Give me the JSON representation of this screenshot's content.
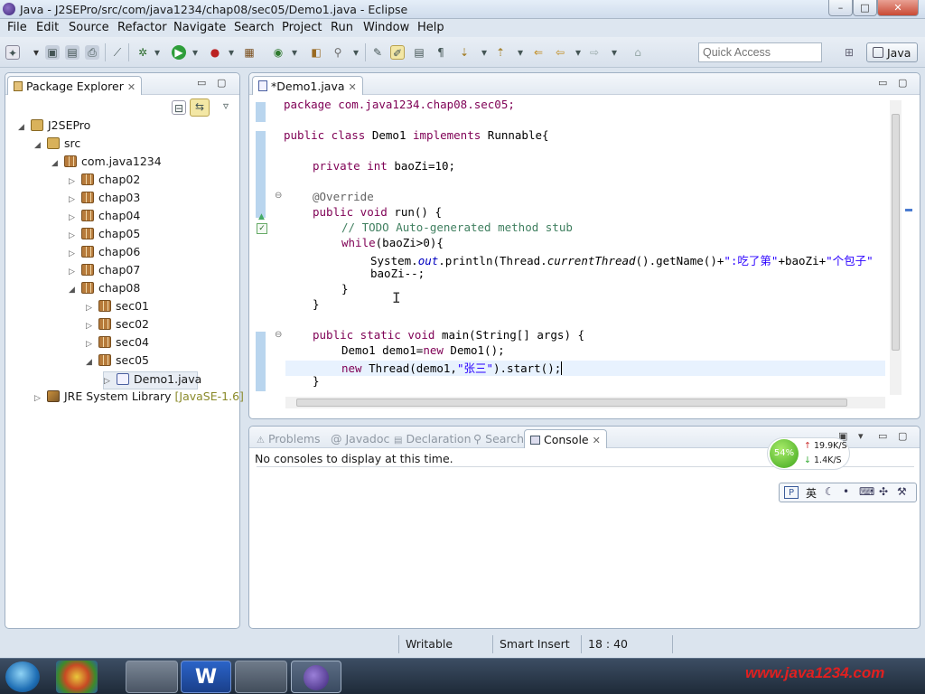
{
  "window": {
    "title": "Java - J2SEPro/src/com/java1234/chap08/sec05/Demo1.java - Eclipse",
    "minimize": "–",
    "maximize": "□",
    "close": "✕"
  },
  "menu": [
    "File",
    "Edit",
    "Source",
    "Refactor",
    "Navigate",
    "Search",
    "Project",
    "Run",
    "Window",
    "Help"
  ],
  "toolbar": {
    "quick_access_placeholder": "Quick Access",
    "perspective": "Java"
  },
  "package_explorer": {
    "tab": "Package Explorer",
    "tree": [
      {
        "label": "J2SEPro",
        "icon": "project-icon"
      },
      {
        "label": "src",
        "icon": "source-folder-icon"
      },
      {
        "label": "com.java1234",
        "icon": "package-icon"
      },
      {
        "label": "chap02",
        "icon": "package-icon"
      },
      {
        "label": "chap03",
        "icon": "package-icon"
      },
      {
        "label": "chap04",
        "icon": "package-icon"
      },
      {
        "label": "chap05",
        "icon": "package-icon"
      },
      {
        "label": "chap06",
        "icon": "package-icon"
      },
      {
        "label": "chap07",
        "icon": "package-icon"
      },
      {
        "label": "chap08",
        "icon": "package-icon"
      },
      {
        "label": "sec01",
        "icon": "package-icon"
      },
      {
        "label": "sec02",
        "icon": "package-icon"
      },
      {
        "label": "sec04",
        "icon": "package-icon"
      },
      {
        "label": "sec05",
        "icon": "package-icon"
      },
      {
        "label": "Demo1.java",
        "icon": "java-file-icon"
      },
      {
        "label": "JRE System Library",
        "suffix": "[JavaSE-1.6]",
        "icon": "library-icon"
      }
    ]
  },
  "editor": {
    "tab": "*Demo1.java",
    "code": {
      "l1": "package com.java1234.chap08.sec05;",
      "l3_kw": "public class",
      "l3_rest": " Demo1 ",
      "l3_kw2": "implements",
      "l3_end": " Runnable{",
      "l5_kw": "private int",
      "l5_rest": " baoZi=10;",
      "l7": "@Override",
      "l8_kw": "public void",
      "l8_rest": " run() {",
      "l9": "// TODO Auto-generated method stub",
      "l10_kw": "while",
      "l10_rest": "(baoZi>0){",
      "l11_a": "System.",
      "l11_b": "out",
      "l11_c": ".println(Thread.",
      "l11_d": "currentThread",
      "l11_e": "().getName()+",
      "l11_f": "\":吃了第\"",
      "l11_g": "+baoZi+",
      "l11_h": "\"个包子\"",
      "l12": "baoZi--;",
      "l13": "}",
      "l14": "}",
      "l16_kw": "public static void",
      "l16_rest": " main(String[] args) {",
      "l17_a": "Demo1 demo1=",
      "l17_kw": "new",
      "l17_b": " Demo1();",
      "l18_kw": "new",
      "l18_a": " Thread(demo1,",
      "l18_str": "\"张三\"",
      "l18_b": ").start();",
      "l19": "}"
    }
  },
  "bottom": {
    "tabs": [
      "Problems",
      "Javadoc",
      "Declaration",
      "Search",
      "Console"
    ],
    "message": "No consoles to display at this time.",
    "net": {
      "percent": "54%",
      "up": "19.9K/S",
      "down": "1.4K/S"
    },
    "ime": {
      "label": "英"
    }
  },
  "status": {
    "writable": "Writable",
    "insert_mode": "Smart Insert",
    "position": "18 : 40"
  },
  "watermark": "www.java1234.com",
  "colors": {
    "keyword": "#7f0055",
    "comment": "#3f7f5f",
    "string": "#2a00ff",
    "field": "#0000c0"
  }
}
